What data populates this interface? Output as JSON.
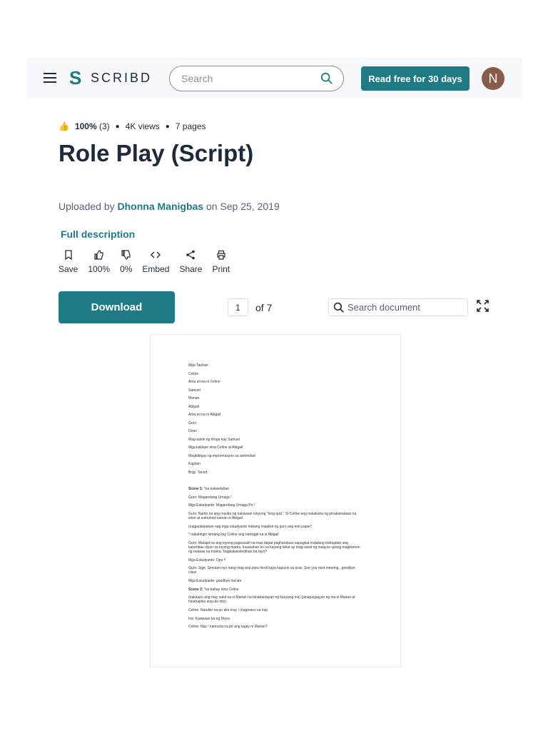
{
  "header": {
    "logo": "SCRIBD",
    "search_placeholder": "Search",
    "cta": "Read free for 30 days",
    "avatar_initial": "N"
  },
  "meta": {
    "rating": "100%",
    "rating_count": "(3)",
    "views": "4K views",
    "pages": "7 pages"
  },
  "title": "Role Play (Script)",
  "upload": {
    "prefix": "Uploaded by",
    "author": "Dhonna Manigbas",
    "suffix": "on Sep 25, 2019"
  },
  "full_description": "Full description",
  "actions": [
    {
      "label": "Save",
      "icon": "bookmark-icon"
    },
    {
      "label": "100%",
      "icon": "thumbs-up-icon"
    },
    {
      "label": "0%",
      "icon": "thumbs-down-icon"
    },
    {
      "label": "Embed",
      "icon": "code-icon"
    },
    {
      "label": "Share",
      "icon": "share-icon"
    },
    {
      "label": "Print",
      "icon": "printer-icon"
    }
  ],
  "download": "Download",
  "pager": {
    "current": "1",
    "of": "of 7"
  },
  "doc_search_placeholder": "Search document",
  "document": {
    "cast": [
      "Mga Tauhan:",
      "Celine",
      "Ama at ina ni Celine",
      "Samuel",
      "Marian",
      "Abigail",
      "Ama at ina ni Abigail",
      "Guro",
      "Dean",
      "Mag-aalok ng droga kay Samuel",
      "Mga kaklase nina Celine at Abigail",
      "Magbibigay ng impormasyon sa awtoridad",
      "Kapitan",
      "Brgy. Tanod"
    ],
    "scene1_label": "Scene 1:",
    "scene1_place": "*sa eskwelahan",
    "scene1": [
      "Guro: Magandang Umaga !",
      "Mga Estudyante: Magandang Umaga Po !",
      "Guro: Narito na ang resulta ng nakaraan ninyong \"long quiz\". Si Celine ang nakakuha ng pinakamataas na iskor at sumunod naman si Abigail",
      "(nagpalakpakan nag mga estudyante habang iniaabot ng guro ang test paper)",
      "* nakatingin lamang kay Celine ang naiinggit na si Abigail",
      "Guro: Malapit na ang inyong pagsusulit na mas dapat paghandaan sapagkat malaking bahagdan ang katumbas niyon sa inyong marka. Inaasahan ko na kayong lahat ay mag-aaral ng maayos upang magkaroon ng mataas na marka. Nagkakaintindihan ba tayo?",
      "Mga Estudyante: Opo !!",
      "Guro: Sige. Simulan nyo nang mag aral para hindi kayo kapusin sa oras. See you next meeting.. goodbye class",
      "Mga Estudyante: goodbye ma'am"
    ],
    "scene2_label": "Scene 2:",
    "scene2_place": "*sa bahay nina Celine",
    "scene2": [
      "(nakaupo ang may sakit na si Marian na binabantayan ng kanyang ina) (pinapaypayan ng ina si Marian at hinahaplos ang ulo nito)",
      "Celine: Nandito na po ako inay ! (nagmano sa ina)",
      "Ina: Kaawaan ka ng Diyos",
      "Celine: Nay ! kamusta na po ang lagay ni Marian?"
    ]
  }
}
